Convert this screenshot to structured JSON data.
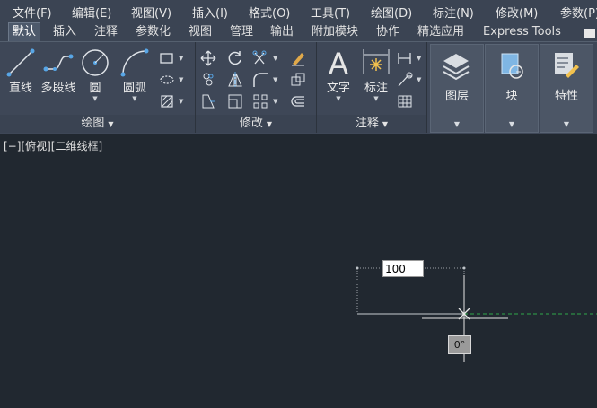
{
  "menubar": {
    "items": [
      "文件(F)",
      "编辑(E)",
      "视图(V)",
      "插入(I)",
      "格式(O)",
      "工具(T)",
      "绘图(D)",
      "标注(N)",
      "修改(M)",
      "参数(P)"
    ]
  },
  "tabs": {
    "items": [
      "默认",
      "插入",
      "注释",
      "参数化",
      "视图",
      "管理",
      "输出",
      "附加模块",
      "协作",
      "精选应用",
      "Express Tools"
    ],
    "active": "默认"
  },
  "ribbon": {
    "draw": {
      "title": "绘图",
      "line": "直线",
      "polyline": "多段线",
      "circle": "圆",
      "arc": "圆弧"
    },
    "modify": {
      "title": "修改"
    },
    "annotation": {
      "title": "注释",
      "text": "文字",
      "dimension": "标注"
    },
    "layers": {
      "label": "图层"
    },
    "block": {
      "label": "块"
    },
    "properties": {
      "label": "特性"
    }
  },
  "canvas": {
    "viewport_label": "[−][俯视][二维线框]",
    "dim_input": "100",
    "angle_readout": "0°"
  },
  "colors": {
    "canvas_bg": "#212830",
    "ribbon_bg": "#3e4757",
    "menubar_bg": "#3b4453",
    "accent_blue": "#58a6e6",
    "green_guide": "#2fa84a"
  },
  "icons": [
    "line-icon",
    "polyline-icon",
    "circle-icon",
    "arc-icon",
    "rectangle-icon",
    "hatch-icon",
    "move-icon",
    "rotate-icon",
    "trim-icon",
    "copy-icon",
    "mirror-icon",
    "fillet-icon",
    "scale-icon",
    "array-icon",
    "offset-icon",
    "erase-icon",
    "text-icon",
    "dimension-icon",
    "table-icon",
    "leader-icon",
    "layers-icon",
    "block-icon",
    "properties-icon"
  ]
}
